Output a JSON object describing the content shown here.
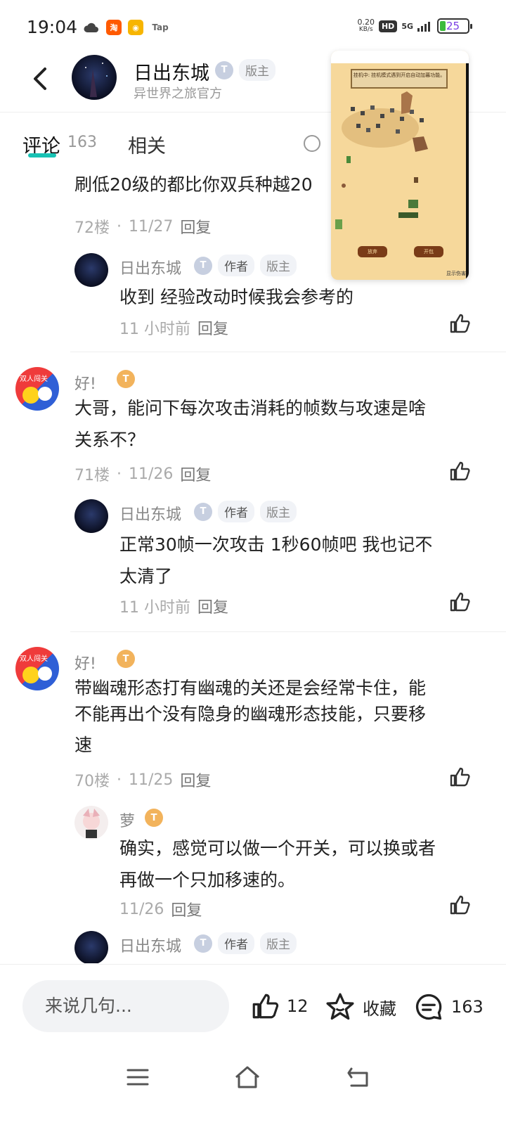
{
  "status": {
    "time": "19:04",
    "speed_top": "0.20",
    "speed_unit": "KB/s",
    "hd": "HD",
    "net": "5G",
    "battery": "25",
    "app_icons": [
      {
        "name": "taobao-icon",
        "glyph": "淘",
        "color": "#ff5a00"
      },
      {
        "name": "weibo-icon",
        "glyph": "◉",
        "color": "#f7b500"
      },
      {
        "name": "tap-icon",
        "glyph": "Tap",
        "color": "#666666"
      }
    ]
  },
  "header": {
    "name": "日出东城",
    "subtitle": "异世界之旅官方",
    "tag": "版主"
  },
  "tabs": {
    "comments_label": "评论",
    "comments_count": "163",
    "related_label": "相关"
  },
  "overlay": {
    "banner": "挂机中: 挂机模式遇到开启自动加暮功能。",
    "btn_left": "放弃",
    "btn_right": "开包",
    "footer": "显示伤害"
  },
  "comments": [
    {
      "text": "刷低20级的都比你双兵种越20",
      "floor": "72楼",
      "date": "11/27",
      "reply_label": "回复"
    },
    {
      "reply_user": "日出东城",
      "reply_tags": [
        "作者",
        "版主"
      ],
      "reply_text": "收到 经验改动时候我会参考的",
      "reply_time": "11 小时前",
      "reply_label": "回复"
    },
    {
      "user": "好!",
      "text_line1": "大哥，能问下每次攻击消耗的帧数与攻速是啥",
      "text_line2": "关系不？",
      "floor": "71楼",
      "date": "11/26",
      "reply_label": "回复",
      "reply_user": "日出东城",
      "reply_tags": [
        "作者",
        "版主"
      ],
      "reply_text_line1": "正常30帧一次攻击  1秒60帧吧  我也记不",
      "reply_text_line2": "太清了",
      "reply_time": "11 小时前"
    },
    {
      "user": "好!",
      "text_line1": "带幽魂形态打有幽魂的关还是会经常卡住，能",
      "text_line2": "不能再出个没有隐身的幽魂形态技能，只要移",
      "text_line3": "速",
      "floor": "70楼",
      "date": "11/25",
      "reply_label": "回复",
      "reply1_user": "萝",
      "reply1_text_line1": "确实，感觉可以做一个开关，可以换或者",
      "reply1_text_line2": "再做一个只加移速的。",
      "reply1_date": "11/26",
      "reply2_user": "日出东城",
      "reply2_tags": [
        "作者",
        "版主"
      ]
    }
  ],
  "bottom": {
    "input_placeholder": "来说几句...",
    "like_count": "12",
    "favorite_label": "收藏",
    "comment_count": "163"
  },
  "colors": {
    "accent": "#18c2b4",
    "gold_badge": "#f2b35c"
  }
}
